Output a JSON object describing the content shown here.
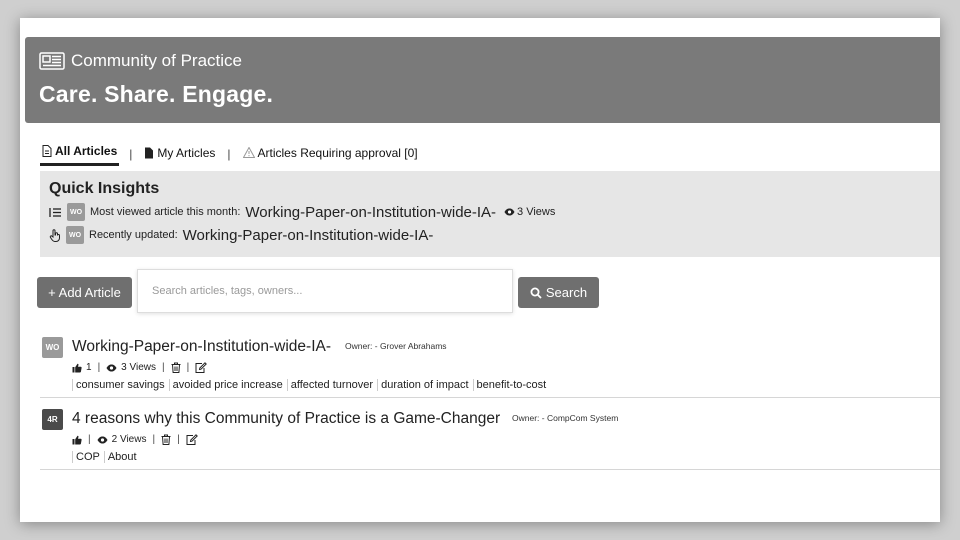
{
  "header": {
    "brand": "Community of Practice",
    "tagline": "Care. Share. Engage."
  },
  "tabs": [
    {
      "label": "All Articles",
      "active": true
    },
    {
      "label": "My Articles"
    },
    {
      "label": "Articles Requiring approval [0]"
    }
  ],
  "tab_separator": "|",
  "insights": {
    "title": "Quick Insights",
    "most_viewed": {
      "label": "Most viewed article this month:",
      "badge": "WO",
      "article": "Working-Paper-on-Institution-wide-IA-",
      "views": "3 Views"
    },
    "recently_updated": {
      "label": "Recently updated:",
      "badge": "WO",
      "article": "Working-Paper-on-Institution-wide-IA-"
    }
  },
  "toolbar": {
    "add_label": "+ Add Article",
    "search_placeholder": "Search articles, tags, owners...",
    "search_label": "Search"
  },
  "articles": [
    {
      "badge": "WO",
      "title": "Working-Paper-on-Institution-wide-IA-",
      "owner": "Owner: - Grover Abrahams",
      "likes": "1",
      "views": "3 Views",
      "tags": [
        "consumer savings",
        "avoided price increase",
        "affected turnover",
        "duration of impact",
        "benefit-to-cost"
      ]
    },
    {
      "badge": "4R",
      "title": "4 reasons why this Community of Practice is a Game-Changer",
      "owner": "Owner: - CompCom System",
      "views": "2 Views",
      "tags": [
        "COP",
        "About"
      ]
    }
  ],
  "meta_separator": "|",
  "colors": {
    "banner": "#7a7a7a",
    "insights_bg": "#e6e6e6",
    "button": "#6f6f6f"
  }
}
